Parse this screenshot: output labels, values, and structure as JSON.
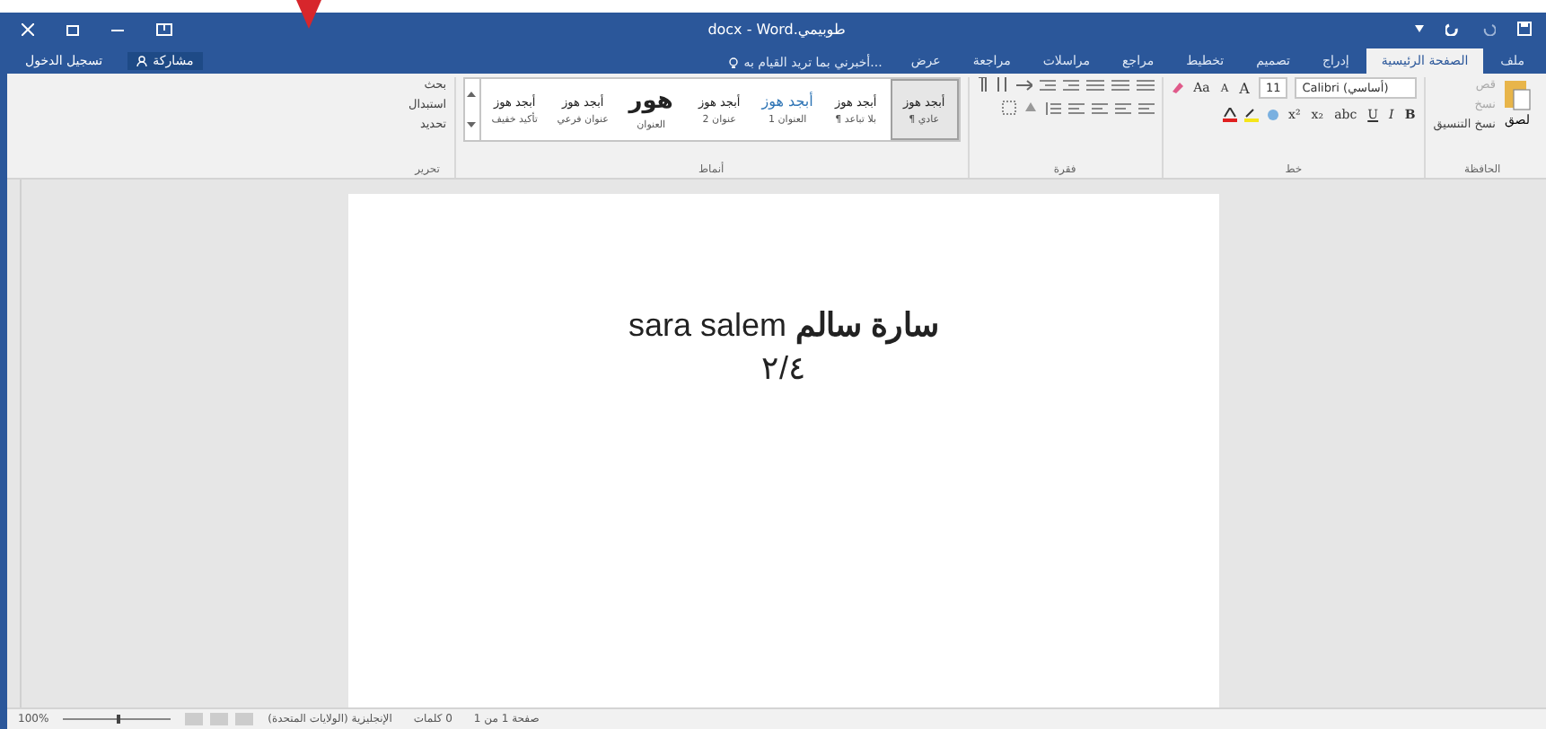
{
  "window": {
    "title": "طوبيمي.docx - Word"
  },
  "quick_access": {
    "pointer": true
  },
  "account": {
    "sign_in": "تسجيل الدخول",
    "share": "مشاركة"
  },
  "tabs": [
    {
      "label": "ملف",
      "selected": false
    },
    {
      "label": "الصفحة الرئيسية",
      "selected": true
    },
    {
      "label": "إدراج",
      "selected": false
    },
    {
      "label": "تصميم",
      "selected": false
    },
    {
      "label": "تخطيط",
      "selected": false
    },
    {
      "label": "مراجع",
      "selected": false
    },
    {
      "label": "مراسلات",
      "selected": false
    },
    {
      "label": "مراجعة",
      "selected": false
    },
    {
      "label": "عرض",
      "selected": false
    }
  ],
  "tell_me": {
    "placeholder": "أخبرني بما تريد القيام به..."
  },
  "clipboard": {
    "name": "الحافظة",
    "paste": "لصق",
    "cut": "قص",
    "copy": "نسخ",
    "format_painter": "نسخ التنسيق"
  },
  "font": {
    "name": "خط",
    "family": "Calibri (أساسي)",
    "size": "11",
    "grow": "A",
    "shrink": "A",
    "case": "Aa",
    "formats": [
      "B",
      "I",
      "U",
      "abc",
      "x₂",
      "x²"
    ]
  },
  "paragraph": {
    "name": "فقرة"
  },
  "styles": {
    "name": "أنماط",
    "items": [
      {
        "sample": "أبجد هوز",
        "label": "¶ عادي",
        "selected": true,
        "kind": "body"
      },
      {
        "sample": "أبجد هوز",
        "label": "¶ بلا تباعد",
        "selected": false,
        "kind": "body"
      },
      {
        "sample": "أبجد هوز",
        "label": "العنوان 1",
        "selected": false,
        "kind": "heading"
      },
      {
        "sample": "أبجد هوز",
        "label": "عنوان 2",
        "selected": false,
        "kind": "body"
      },
      {
        "sample": "هور",
        "label": "العنوان",
        "selected": false,
        "kind": "title"
      },
      {
        "sample": "أبجد هوز",
        "label": "عنوان فرعي",
        "selected": false,
        "kind": "body"
      },
      {
        "sample": "أبجد هوز",
        "label": "تأكيد خفيف",
        "selected": false,
        "kind": "body"
      }
    ]
  },
  "editing": {
    "name": "تحرير",
    "items": [
      "بحث",
      "استبدال",
      "تحديد"
    ]
  },
  "document": {
    "lines": [
      "**سارة سالم** sara salem",
      "٢/٤"
    ]
  },
  "status_bar": {
    "page": "صفحة 1 من 1",
    "words": "0 كلمات",
    "language": "الإنجليزية (الولايات المتحدة)",
    "zoom": "100%",
    "level": 0.5
  }
}
